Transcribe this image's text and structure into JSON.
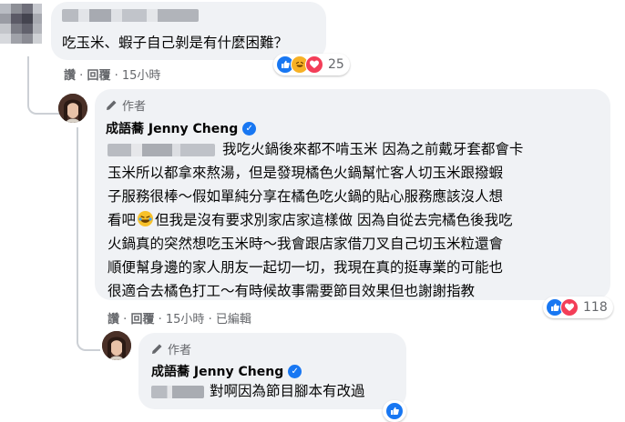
{
  "comment": {
    "text": "吃玉米、蝦子自己剝是有什麼困難？",
    "reactions_count": "25",
    "actions": {
      "like": "讚",
      "reply": "回覆",
      "time": "15小時"
    }
  },
  "author_reply": {
    "author_label": "作者",
    "name": "成語蕎 Jenny Cheng",
    "lines": [
      "我吃火鍋後來都不啃玉米 因為之前戴牙套都會卡",
      "玉米所以都拿來熬湯，但是發現橘色火鍋幫忙客人切玉米跟撥蝦",
      "子服務很棒～假如單純分享在橘色吃火鍋的貼心服務應該沒人想",
      "看吧",
      "但我是沒有要求別家店家這樣做 因為自從去完橘色後我吃",
      "火鍋真的突然想吃玉米時～我會跟店家借刀叉自己切玉米粒還會",
      "順便幫身邊的家人朋友一起切一切，我現在真的挺專業的可能也",
      "很適合去橘色打工～有時候故事需要節目效果但也謝謝指教"
    ],
    "reactions_count": "118",
    "actions": {
      "like": "讚",
      "reply": "回覆",
      "time": "15小時",
      "edited": "已編輯"
    }
  },
  "nested_reply": {
    "author_label": "作者",
    "name": "成語蕎 Jenny Cheng",
    "text": "對啊因為節目腳本有改過"
  },
  "separator": "·",
  "colors": {
    "bubble": "#f0f2f5",
    "meta": "#65676b",
    "verified": "#1877f2",
    "like": "#1877f2",
    "love": "#f33e58",
    "haha": "#f7b125"
  }
}
